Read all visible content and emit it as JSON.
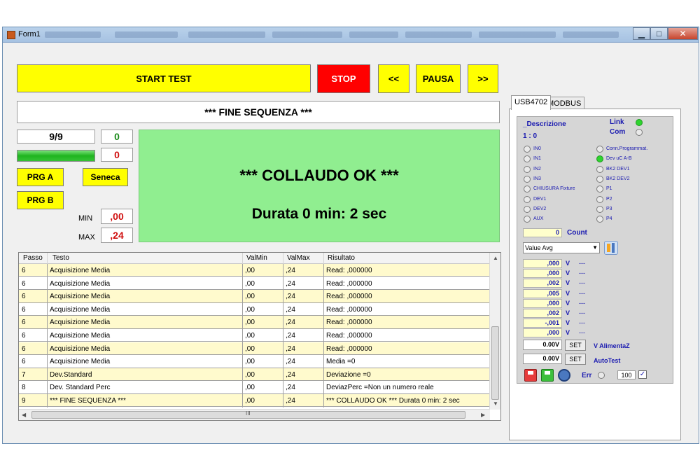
{
  "window": {
    "title": "Form1",
    "minimize": "▁",
    "maximize": "□",
    "close": "✕"
  },
  "controls": {
    "start_label": "START TEST",
    "stop_label": "STOP",
    "prev_label": "<<",
    "pause_label": "PAUSA",
    "next_label": ">>",
    "prg_a_label": "PRG A",
    "prg_b_label": "PRG B",
    "seneca_label": "Seneca"
  },
  "status": {
    "sequence_message": "*** FINE SEQUENZA ***",
    "step_counter": "9/9",
    "ok_count": "0",
    "error_count": "0",
    "progress_fraction": 1.0,
    "min_label": "MIN",
    "min_value": ",00",
    "max_label": "MAX",
    "max_value": ",24",
    "result_title": "*** COLLAUDO OK  ***",
    "duration": "Durata 0 min: 2 sec"
  },
  "colors": {
    "accent_yellow": "#ffff00",
    "stop_red": "#ff0000",
    "ok_green": "#90ee90",
    "row_alt": "#fffacd"
  },
  "grid": {
    "columns": [
      "Passo",
      "Testo",
      "ValMin",
      "ValMax",
      "Risultato"
    ],
    "rows": [
      {
        "step": "6",
        "text": "Acquisizione Media",
        "min": ",00",
        "max": ",24",
        "result": "Read: ,000000",
        "alt": true
      },
      {
        "step": "6",
        "text": "Acquisizione Media",
        "min": ",00",
        "max": ",24",
        "result": "Read: ,000000",
        "alt": false
      },
      {
        "step": "6",
        "text": "Acquisizione Media",
        "min": ",00",
        "max": ",24",
        "result": "Read: ,000000",
        "alt": true
      },
      {
        "step": "6",
        "text": "Acquisizione Media",
        "min": ",00",
        "max": ",24",
        "result": "Read: ,000000",
        "alt": false
      },
      {
        "step": "6",
        "text": "Acquisizione Media",
        "min": ",00",
        "max": ",24",
        "result": "Read: ,000000",
        "alt": true
      },
      {
        "step": "6",
        "text": "Acquisizione Media",
        "min": ",00",
        "max": ",24",
        "result": "Read: ,000000",
        "alt": false
      },
      {
        "step": "6",
        "text": "Acquisizione Media",
        "min": ",00",
        "max": ",24",
        "result": "Read: ,000000",
        "alt": true
      },
      {
        "step": "6",
        "text": "Acquisizione Media",
        "min": ",00",
        "max": ",24",
        "result": "Media =0",
        "alt": false
      },
      {
        "step": "7",
        "text": "Dev.Standard",
        "min": ",00",
        "max": ",24",
        "result": "Deviazione =0",
        "alt": true
      },
      {
        "step": "8",
        "text": "Dev. Standard Perc",
        "min": ",00",
        "max": ",24",
        "result": "DeviazPerc =Non un numero reale",
        "alt": false
      },
      {
        "step": "9",
        "text": "*** FINE SEQUENZA ***",
        "min": ",00",
        "max": ",24",
        "result": "*** COLLAUDO OK  *** Durata 0 min: 2 sec",
        "alt": true
      }
    ],
    "hscroll_grip": "III"
  },
  "side": {
    "tabs": [
      "USB4702",
      "MODBUS"
    ],
    "descrizione": "_Descrizione",
    "ratio": "1 : 0",
    "link_label": "Link",
    "com_label": "Com",
    "link_on": true,
    "com_on": false,
    "inputs_left": [
      "IN0",
      "IN1",
      "IN2",
      "IN3",
      "CHIUSURA Fixture",
      "DEV1",
      "DEV2",
      "AUX"
    ],
    "inputs_right": [
      "Conn.Programmat.",
      "Dev uC A-B",
      "BK2 DEV1",
      "BK2 DEV2",
      "P1",
      "P2",
      "P3",
      "P4"
    ],
    "right_on_index": 1,
    "count_value": "0",
    "count_label": "Count",
    "value_select": "Value Avg",
    "channel_values": [
      ",000",
      ",000",
      ",002",
      ",005",
      ",000",
      ",002",
      "-,001",
      ",000"
    ],
    "unit": "V",
    "dashes": "---",
    "supply_value": "0.00V",
    "supply_set": "SET",
    "supply_label": "V AlimentaZ",
    "autotest_value": "0.00V",
    "autotest_set": "SET",
    "autotest_label": "AutoTest",
    "err_label": "Err",
    "err_value": "100",
    "checked": "✓"
  }
}
